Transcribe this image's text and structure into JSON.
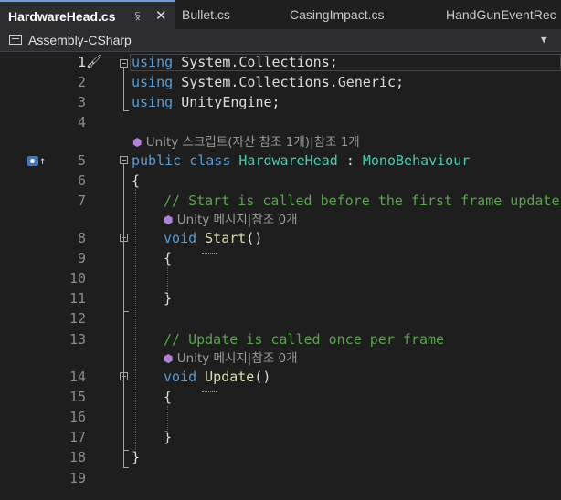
{
  "tabs": [
    {
      "label": "HardwareHead.cs",
      "pin_icon": "pin-icon",
      "close_icon": "close-icon",
      "active": true
    },
    {
      "label": "Bullet.cs"
    },
    {
      "label": "CasingImpact.cs"
    },
    {
      "label": "HandGunEventRec"
    }
  ],
  "nav": {
    "project": "Assembly-CSharp",
    "project_icon": "project-icon",
    "dropdown_icon": "chevron-down-icon"
  },
  "lines": [
    {
      "no": "1",
      "tokens": [
        [
          "kw",
          "using"
        ],
        [
          "",
          "System.Collections;"
        ]
      ]
    },
    {
      "no": "2",
      "tokens": [
        [
          "kw",
          "using"
        ],
        [
          "",
          "System.Collections.Generic;"
        ]
      ]
    },
    {
      "no": "3",
      "tokens": [
        [
          "kw",
          "using"
        ],
        [
          "",
          "UnityEngine;"
        ]
      ]
    },
    {
      "no": "4",
      "tokens": []
    },
    {
      "no": "5",
      "tokens": [
        [
          "kw",
          "public"
        ],
        [
          "kw",
          "class"
        ],
        [
          "cls",
          "HardwareHead"
        ],
        [
          "",
          ":"
        ],
        [
          "cls",
          "MonoBehaviour"
        ]
      ]
    },
    {
      "no": "6",
      "tokens": [
        [
          "",
          "{"
        ]
      ]
    },
    {
      "no": "7",
      "tokens": [
        [
          "cmt",
          "// Start is called before the first frame update"
        ]
      ]
    },
    {
      "no": "8",
      "tokens": [
        [
          "kw",
          "void"
        ],
        [
          "meth",
          "Start"
        ],
        [
          "",
          "()"
        ]
      ]
    },
    {
      "no": "9",
      "tokens": [
        [
          "",
          "{"
        ]
      ]
    },
    {
      "no": "10",
      "tokens": []
    },
    {
      "no": "11",
      "tokens": [
        [
          "",
          "}"
        ]
      ]
    },
    {
      "no": "12",
      "tokens": []
    },
    {
      "no": "13",
      "tokens": [
        [
          "cmt",
          "// Update is called once per frame"
        ]
      ]
    },
    {
      "no": "14",
      "tokens": [
        [
          "kw",
          "void"
        ],
        [
          "meth",
          "Update"
        ],
        [
          "",
          "()"
        ]
      ]
    },
    {
      "no": "15",
      "tokens": [
        [
          "",
          "{"
        ]
      ]
    },
    {
      "no": "16",
      "tokens": []
    },
    {
      "no": "17",
      "tokens": [
        [
          "",
          "}"
        ]
      ]
    },
    {
      "no": "18",
      "tokens": [
        [
          "",
          "}"
        ]
      ]
    },
    {
      "no": "19",
      "tokens": []
    }
  ],
  "codelens": {
    "class_lens": "Unity 스크립트(자산 참조 1개)|참조 1개",
    "start_lens": "Unity 메시지|참조 0개",
    "update_lens": "Unity 메시지|참조 0개"
  },
  "colors": {
    "keyword": "#569cd6",
    "type": "#4ec9b0",
    "comment": "#57a64a",
    "method": "#dcdcaa",
    "background": "#1e1e1e"
  }
}
